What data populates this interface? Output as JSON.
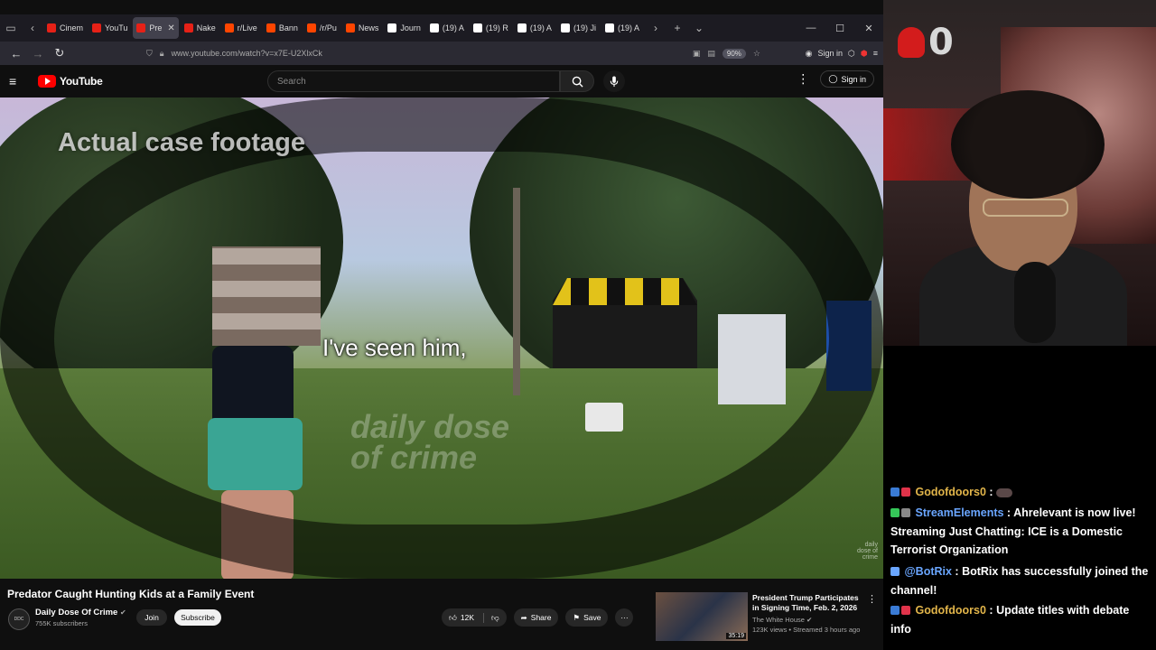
{
  "browser": {
    "tabs": [
      {
        "label": "Cinem",
        "color": "#e62117"
      },
      {
        "label": "YouTu",
        "color": "#e62117"
      },
      {
        "label": "Pre",
        "color": "#e62117",
        "active": true
      },
      {
        "label": "Nake",
        "color": "#e62117"
      },
      {
        "label": "r/Live",
        "color": "#ff4500"
      },
      {
        "label": "Bann",
        "color": "#ff4500"
      },
      {
        "label": "/r/Pu",
        "color": "#ff4500"
      },
      {
        "label": "News",
        "color": "#ff4500"
      },
      {
        "label": "Journ",
        "color": "#ffffff"
      },
      {
        "label": "(19) A",
        "color": "#ffffff"
      },
      {
        "label": "(19) R",
        "color": "#ffffff"
      },
      {
        "label": "(19) A",
        "color": "#ffffff"
      },
      {
        "label": "(19) Ji",
        "color": "#ffffff"
      },
      {
        "label": "(19) A",
        "color": "#ffffff"
      }
    ],
    "url": "www.youtube.com/watch?v=x7E-U2XlxCk",
    "zoom": "90%",
    "sign_in": "Sign in",
    "notif_count": "18"
  },
  "youtube": {
    "logo_text": "YouTube",
    "search_placeholder": "Search",
    "sign_in": "Sign in"
  },
  "video": {
    "overlay_title": "Actual case footage",
    "caption": "I've seen him,",
    "watermark": "daily dose of crime",
    "watermark_small": "daily dose of crime"
  },
  "details": {
    "title": "Predator Caught Hunting Kids at a Family Event",
    "channel": "Daily Dose Of Crime",
    "subscribers": "755K subscribers",
    "join": "Join",
    "subscribe": "Subscribe",
    "likes": "12K",
    "share": "Share",
    "save": "Save"
  },
  "recommended": {
    "title": "President Trump Participates in Signing Time, Feb. 2, 2026",
    "channel": "The White House",
    "meta": "123K views • Streamed 3 hours ago",
    "duration": "35:19"
  },
  "stream": {
    "counter": "0"
  },
  "chat": [
    {
      "user": "Godofdoors0",
      "text": "",
      "color": "gold",
      "emote": true
    },
    {
      "user": "StreamElements",
      "text": "Ahrelevant is now live! Streaming Just Chatting: ICE is a Domestic Terrorist Organization",
      "color": "blue"
    },
    {
      "user": "@BotRix",
      "text": "BotRix has successfully joined the channel!",
      "color": "blue"
    },
    {
      "user": "Godofdoors0",
      "text": "Update titles with debate info",
      "color": "gold"
    }
  ]
}
